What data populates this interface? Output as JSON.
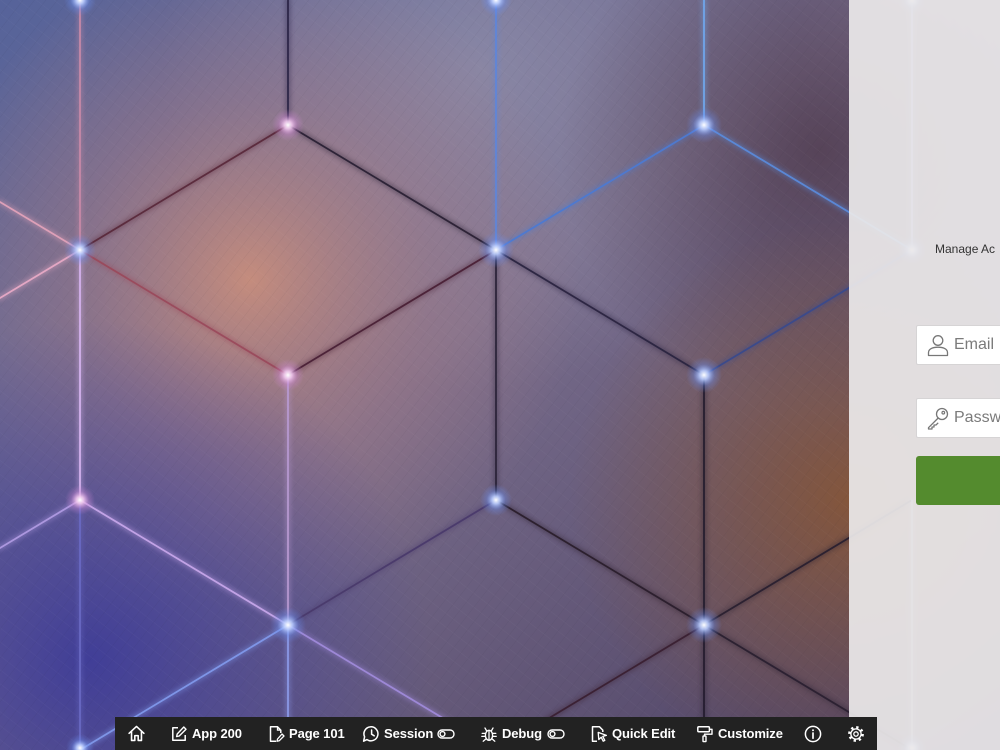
{
  "panel": {
    "manage_link": "Manage Ac"
  },
  "login": {
    "email_placeholder": "Email",
    "password_placeholder": "Passw"
  },
  "toolbar": {
    "app_label": "App 200",
    "page_label": "Page 101",
    "session_label": "Session",
    "debug_label": "Debug",
    "quick_edit_label": "Quick Edit",
    "customize_label": "Customize"
  },
  "icons": {
    "home": "home-icon",
    "app": "edit-icon",
    "page": "page-edit-icon",
    "session": "session-icon",
    "session_toggle": "toggle-icon",
    "debug": "bug-icon",
    "debug_toggle": "toggle-icon",
    "quick_edit": "quick-edit-icon",
    "customize": "paint-roller-icon",
    "info": "info-icon",
    "settings": "gear-icon",
    "email_field": "user-icon",
    "password_field": "key-icon"
  },
  "colors": {
    "login_button": "#548b2e",
    "toolbar_bg": "#222222",
    "panel_bg": "#ebe8ea"
  }
}
